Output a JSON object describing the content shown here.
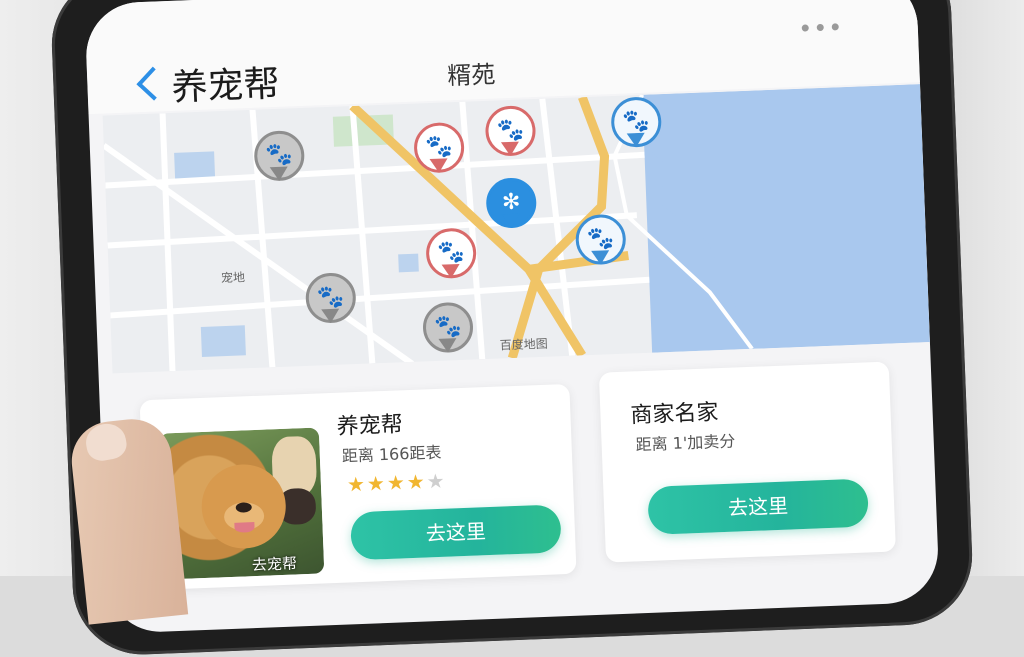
{
  "header": {
    "app_title": "养宠帮",
    "center_title": "糈苑"
  },
  "map": {
    "labels": [
      "宠地"
    ],
    "footer_text": "百度地图"
  },
  "shops": [
    {
      "name": "养宠帮",
      "distance": "距离 166距表",
      "rating": 4,
      "rating_max": 5,
      "photo_caption": "去宠帮",
      "button_label": "去这里"
    },
    {
      "name": "商家名家",
      "distance": "距离 1'加卖分",
      "button_label": "去这里"
    }
  ],
  "colors": {
    "accent": "#2d8fe6",
    "button": "#2ec3a6",
    "star": "#f1b631"
  }
}
